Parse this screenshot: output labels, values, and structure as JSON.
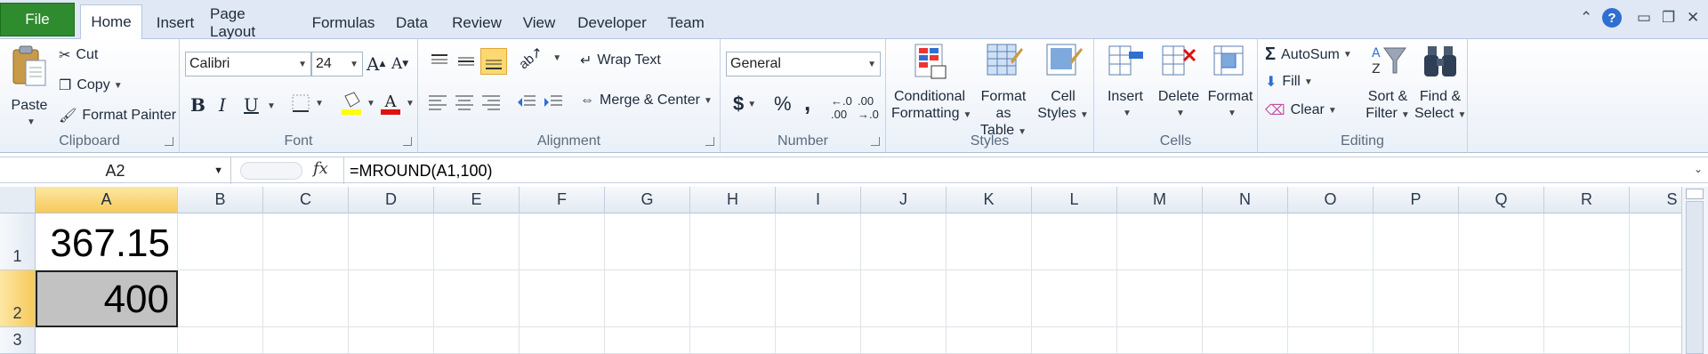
{
  "tabs": {
    "file": "File",
    "items": [
      "Home",
      "Insert",
      "Page Layout",
      "Formulas",
      "Data",
      "Review",
      "View",
      "Developer",
      "Team"
    ],
    "active": "Home"
  },
  "clipboard": {
    "label": "Clipboard",
    "paste": "Paste",
    "cut": "Cut",
    "copy": "Copy",
    "format_painter": "Format Painter"
  },
  "font": {
    "label": "Font",
    "family": "Calibri",
    "size": "24",
    "bold": "B",
    "italic": "I",
    "underline": "U"
  },
  "alignment": {
    "label": "Alignment",
    "wrap_text": "Wrap Text",
    "merge_center": "Merge & Center"
  },
  "number": {
    "label": "Number",
    "format": "General",
    "currency": "$",
    "percent": "%",
    "comma": ","
  },
  "styles": {
    "label": "Styles",
    "conditional_1": "Conditional",
    "conditional_2": "Formatting",
    "format_table_1": "Format",
    "format_table_2": "as Table",
    "cell_styles_1": "Cell",
    "cell_styles_2": "Styles"
  },
  "cells": {
    "label": "Cells",
    "insert": "Insert",
    "delete": "Delete",
    "format": "Format"
  },
  "editing": {
    "label": "Editing",
    "autosum": "AutoSum",
    "fill": "Fill",
    "clear": "Clear",
    "sort_1": "Sort &",
    "sort_2": "Filter",
    "find_1": "Find &",
    "find_2": "Select"
  },
  "formula_bar": {
    "name_box": "A2",
    "fx": "fx",
    "formula": "=MROUND(A1,100)"
  },
  "grid": {
    "columns": [
      "A",
      "B",
      "C",
      "D",
      "E",
      "F",
      "G",
      "H",
      "I",
      "J",
      "K",
      "L",
      "M",
      "N",
      "O",
      "P",
      "Q",
      "R",
      "S"
    ],
    "rows": [
      "1",
      "2",
      "3"
    ],
    "selected_cell": "A2",
    "cells": {
      "A1": "367.15",
      "A2": "400"
    }
  }
}
